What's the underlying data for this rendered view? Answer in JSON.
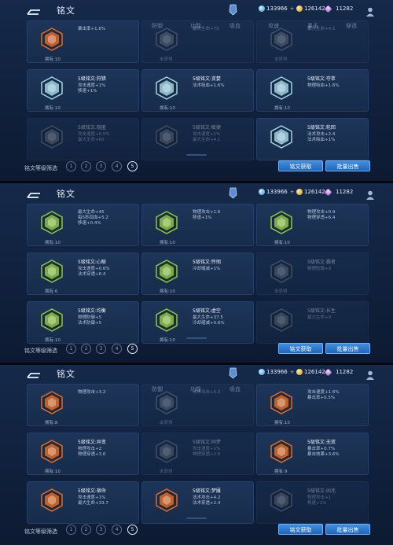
{
  "header": {
    "title": "铭文",
    "currency1": "133966",
    "currency2": "126142",
    "currency3": "11282"
  },
  "tabs": [
    "全部",
    "攻击",
    "生命",
    "防御",
    "功能",
    "吸血",
    "攻速",
    "暴击",
    "穿透"
  ],
  "bottom": {
    "filter_label": "铭文等级筛选",
    "levels": [
      "1",
      "2",
      "3",
      "4",
      "5"
    ],
    "btn_get": "铭文获取",
    "btn_sell": "批量出售"
  },
  "colors": {
    "accent": "#3fa6ff",
    "card_bg": "#1b3254"
  },
  "panels": [
    {
      "cards": [
        {
          "name": "",
          "attrs": [
            "暴击率+1.6%"
          ],
          "owned": "拥有:10",
          "color": "#e06a2a",
          "dim": false
        },
        {
          "name": "",
          "attrs": [
            "最大生命+75"
          ],
          "owned": "未获得",
          "color": "#8a8a8a",
          "dim": true
        },
        {
          "name": "",
          "attrs": [
            "最大生命+4.5"
          ],
          "owned": "未获得",
          "color": "#8a8a8a",
          "dim": true
        },
        {
          "name": "5级铭文:狩猎",
          "attrs": [
            "攻击速度+1%",
            "移速+1%"
          ],
          "owned": "拥有:10",
          "color": "#9fd2e8",
          "dim": false
        },
        {
          "name": "5级铭文:贪婪",
          "attrs": [
            "法术吸血+1.6%"
          ],
          "owned": "拥有:10",
          "color": "#9fd2e8",
          "dim": false
        },
        {
          "name": "5级铭文:夺萃",
          "attrs": [
            "物理吸血+1.6%"
          ],
          "owned": "拥有:10",
          "color": "#9fd2e8",
          "dim": false
        },
        {
          "name": "5级铭文:隐匿",
          "attrs": [
            "攻击速度+0.5%",
            "最大生命+60"
          ],
          "owned": "",
          "color": "#9fd2e8",
          "dim": true
        },
        {
          "name": "5级铭文:敏捷",
          "attrs": [
            "攻击速度+1%",
            "最大生命+4.1"
          ],
          "owned": "",
          "color": "#9fd2e8",
          "dim": true
        },
        {
          "name": "5级铭文:轮回",
          "attrs": [
            "法术攻击+2.4",
            "法术吸血+1%"
          ],
          "owned": "",
          "color": "#9fd2e8",
          "dim": false
        }
      ]
    },
    {
      "cards": [
        {
          "name": "",
          "attrs": [
            "最大生命+45",
            "每5秒回血+5.2",
            "移速+0.4%"
          ],
          "owned": "拥有:10",
          "color": "#8ec63f",
          "dim": false
        },
        {
          "name": "",
          "attrs": [
            "物理攻击+1.6",
            "移速+1%"
          ],
          "owned": "拥有:10",
          "color": "#8ec63f",
          "dim": false
        },
        {
          "name": "",
          "attrs": [
            "物理攻击+0.9",
            "物理穿透+6.4"
          ],
          "owned": "拥有:10",
          "color": "#8ec63f",
          "dim": false
        },
        {
          "name": "5级铭文:心眼",
          "attrs": [
            "攻击速度+0.6%",
            "法术穿透+6.4"
          ],
          "owned": "拥有:6",
          "color": "#8ec63f",
          "dim": false
        },
        {
          "name": "5级铭文:怜悯",
          "attrs": [
            "冷却缩减+1%"
          ],
          "owned": "拥有:10",
          "color": "#8ec63f",
          "dim": false
        },
        {
          "name": "5级铭文:霸者",
          "attrs": [
            "物理防御+9"
          ],
          "owned": "未获得",
          "color": "#8a8a8a",
          "dim": true
        },
        {
          "name": "5级铭文:均衡",
          "attrs": [
            "物理防御+5",
            "法术防御+5"
          ],
          "owned": "拥有:10",
          "color": "#8ec63f",
          "dim": false
        },
        {
          "name": "5级铭文:虚空",
          "attrs": [
            "最大生命+37.5",
            "冷却缩减+0.6%"
          ],
          "owned": "拥有:10",
          "color": "#8ec63f",
          "dim": false
        },
        {
          "name": "5级铭文:长生",
          "attrs": [
            "最大生命+9"
          ],
          "owned": "",
          "color": "#8a8a8a",
          "dim": true
        }
      ]
    },
    {
      "cards": [
        {
          "name": "",
          "attrs": [
            "物理攻击+3.2"
          ],
          "owned": "拥有:8",
          "color": "#e26a25",
          "dim": false
        },
        {
          "name": "",
          "attrs": [
            "法术攻击+5.3"
          ],
          "owned": "未获得",
          "color": "#8a8a8a",
          "dim": true
        },
        {
          "name": "",
          "attrs": [
            "攻击速度+1.6%",
            "暴击率+0.5%"
          ],
          "owned": "拥有:10",
          "color": "#e26a25",
          "dim": false
        },
        {
          "name": "5级铭文:异变",
          "attrs": [
            "物理攻击+2",
            "物理穿透+3.6"
          ],
          "owned": "拥有:10",
          "color": "#e26a25",
          "dim": false
        },
        {
          "name": "5级铭文:同梦",
          "attrs": [
            "攻击速度+1%",
            "物理穿透+2.5"
          ],
          "owned": "未获得",
          "color": "#8a8a8a",
          "dim": true
        },
        {
          "name": "5级铭文:无双",
          "attrs": [
            "暴击率+0.7%",
            "暴击效果+3.6%"
          ],
          "owned": "拥有:9",
          "color": "#e26a25",
          "dim": false
        },
        {
          "name": "5级铭文:宿命",
          "attrs": [
            "攻击速度+1%",
            "最大生命+33.7"
          ],
          "owned": "",
          "color": "#e26a25",
          "dim": false
        },
        {
          "name": "5级铭文:梦魇",
          "attrs": [
            "法术攻击+4.2",
            "法术穿透+2.4"
          ],
          "owned": "",
          "color": "#e26a25",
          "dim": false
        },
        {
          "name": "5级铭文:凶兆",
          "attrs": [
            "物理攻击+1",
            "移速+1%"
          ],
          "owned": "",
          "color": "#8a8a8a",
          "dim": true
        }
      ]
    }
  ]
}
